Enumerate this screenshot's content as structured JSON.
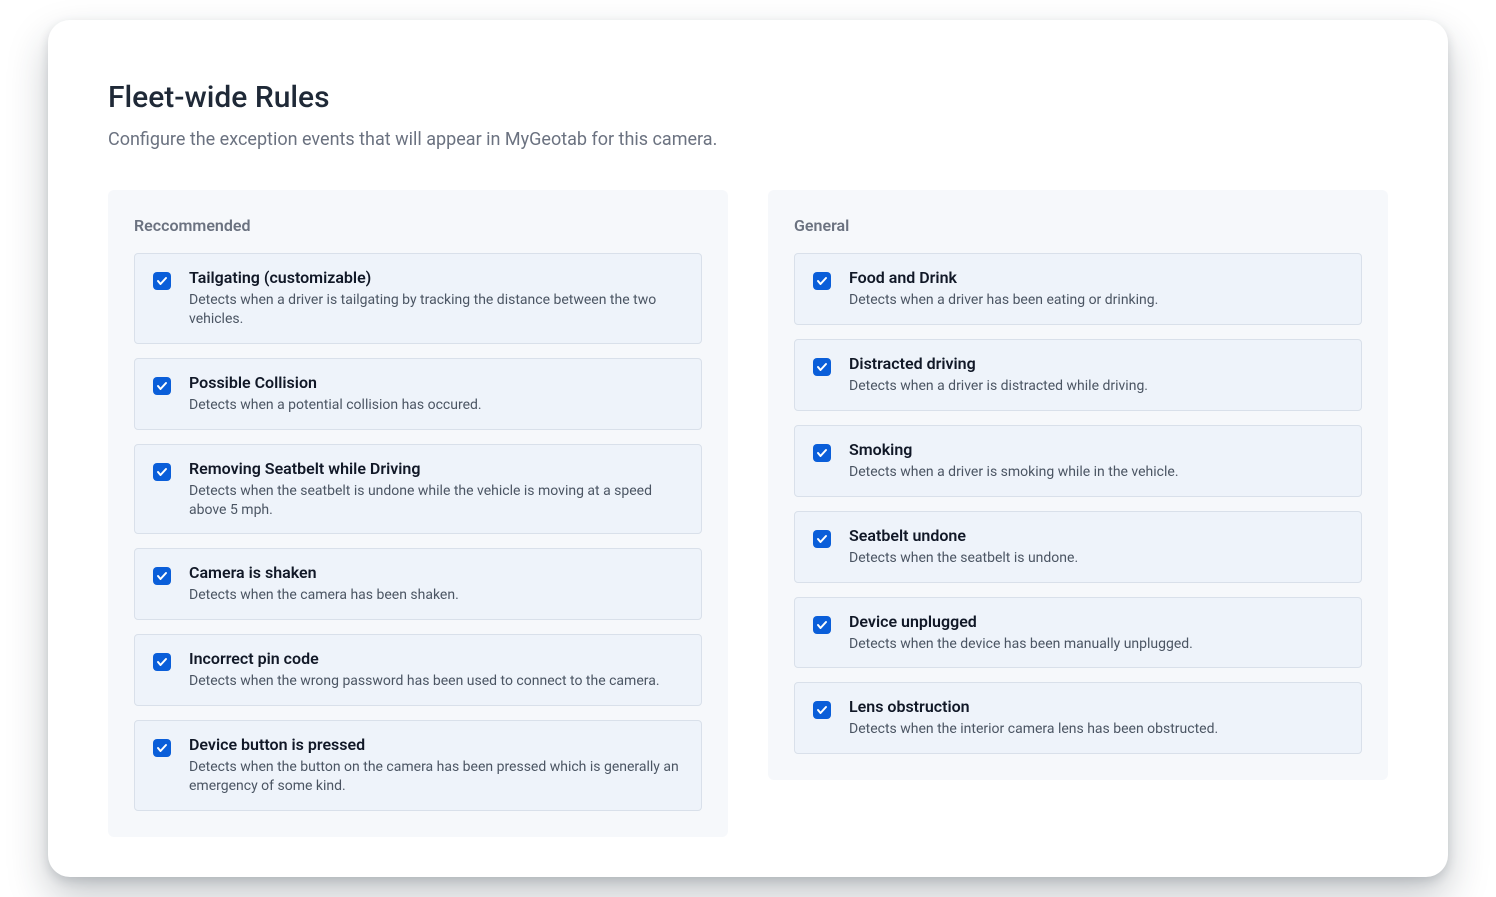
{
  "header": {
    "title": "Fleet-wide Rules",
    "subtitle": "Configure the exception events that will appear in MyGeotab for this camera."
  },
  "sections": [
    {
      "title": "Reccommended",
      "rules": [
        {
          "title": "Tailgating (customizable)",
          "desc": "Detects when a driver is tailgating by tracking the distance between the two vehicles.",
          "checked": true
        },
        {
          "title": "Possible Collision",
          "desc": "Detects when a potential collision has occured.",
          "checked": true
        },
        {
          "title": "Removing Seatbelt while Driving",
          "desc": "Detects when the seatbelt is undone while the vehicle is moving at a speed above 5 mph.",
          "checked": true
        },
        {
          "title": "Camera is shaken",
          "desc": "Detects when the camera has been shaken.",
          "checked": true
        },
        {
          "title": "Incorrect pin code",
          "desc": "Detects when the wrong password has been used to connect to the camera.",
          "checked": true
        },
        {
          "title": "Device button is pressed",
          "desc": "Detects when the button on the camera has been pressed which is generally an emergency of some kind.",
          "checked": true
        }
      ]
    },
    {
      "title": "General",
      "rules": [
        {
          "title": "Food and Drink",
          "desc": "Detects when a driver has been eating or drinking.",
          "checked": true
        },
        {
          "title": "Distracted driving",
          "desc": "Detects when a driver is distracted while driving.",
          "checked": true
        },
        {
          "title": "Smoking",
          "desc": "Detects when a driver is smoking while in the vehicle.",
          "checked": true
        },
        {
          "title": "Seatbelt undone",
          "desc": "Detects when the seatbelt is undone.",
          "checked": true
        },
        {
          "title": "Device unplugged",
          "desc": "Detects when the device has been manually unplugged.",
          "checked": true
        },
        {
          "title": "Lens obstruction",
          "desc": "Detects when the interior camera lens has been obstructed.",
          "checked": true
        }
      ]
    }
  ]
}
